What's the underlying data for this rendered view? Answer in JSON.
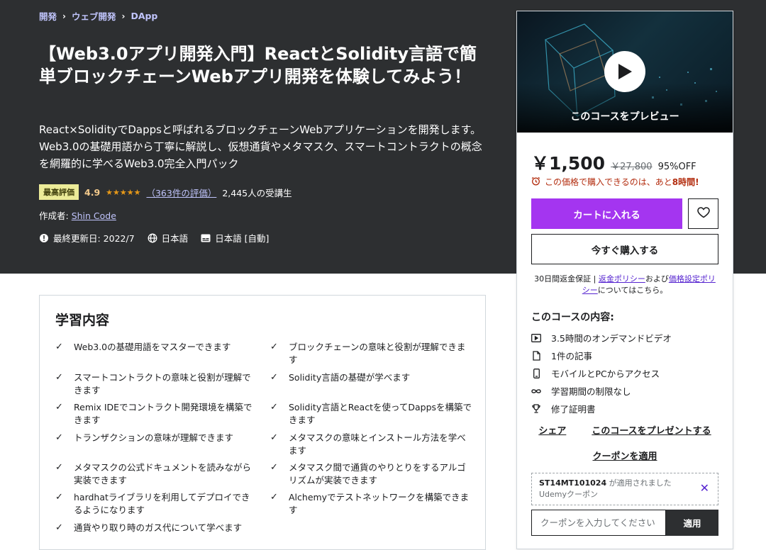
{
  "breadcrumb": [
    "開発",
    "ウェブ開発",
    "DApp"
  ],
  "course": {
    "title": "【Web3.0アプリ開発入門】ReactとSolidity言語で簡単ブロックチェーンWebアプリ開発を体験してみよう！",
    "subtitle": "React×SolidityでDappsと呼ばれるブロックチェーンWebアプリケーションを開発します。Web3.0の基礎用語から丁寧に解説し、仮想通貨やメタマスク、スマートコントラクトの概念を網羅的に学べるWeb3.0完全入門パック",
    "badge": "最高評価",
    "rating": "4.9",
    "stars": "★★★★★",
    "rating_count": "（363件の評価）",
    "students": "2,445人の受講生",
    "author_label": "作成者:",
    "author": "Shin Code",
    "updated": "最終更新日: 2022/7",
    "language": "日本語",
    "captions": "日本語 [自動]"
  },
  "learn": {
    "title": "学習内容",
    "left": [
      "Web3.0の基礎用語をマスターできます",
      "スマートコントラクトの意味と役割が理解できます",
      "Remix IDEでコントラクト開発環境を構築できます",
      "トランザクションの意味が理解できます",
      "メタマスクの公式ドキュメントを読みながら実装できます",
      "hardhatライブラリを利用してデプロイできるようになります",
      "通貨やり取り時のガス代について学べます"
    ],
    "right": [
      "ブロックチェーンの意味と役割が理解できます",
      "Solidity言語の基礎が学べます",
      "Solidity言語とReactを使ってDappsを構築できます",
      "メタマスクの意味とインストール方法を学べます",
      "メタマスク間で通貨のやりとりをするアルゴリズムが実装できます",
      "Alchemyでテストネットワークを構築できます"
    ]
  },
  "sidebar": {
    "preview_label": "このコースをプレビュー",
    "price": "￥1,500",
    "old_price": "￥27,800",
    "discount": "95%OFF",
    "timer_text": "この価格で購入できるのは、あと",
    "timer_bold": "8時間!",
    "cart_button": "カートに入れる",
    "buy_button": "今すぐ購入する",
    "guarantee_prefix": "30日間返金保証 | ",
    "refund_link": "返金ポリシー",
    "and_text": "および",
    "pricing_link": "価格設定ポリシー",
    "guarantee_suffix": "についてはこちら。",
    "includes_title": "このコースの内容:",
    "includes": [
      {
        "icon": "video-icon",
        "text": "3.5時間のオンデマンドビデオ"
      },
      {
        "icon": "article-icon",
        "text": "1件の記事"
      },
      {
        "icon": "mobile-icon",
        "text": "モバイルとPCからアクセス"
      },
      {
        "icon": "infinity-icon",
        "text": "学習期間の制限なし"
      },
      {
        "icon": "trophy-icon",
        "text": "修了証明書"
      }
    ],
    "share": "シェア",
    "gift": "このコースをプレゼントする",
    "apply_coupon": "クーポンを適用",
    "coupon_code": "ST14MT101024",
    "coupon_applied": "が適用されました",
    "coupon_source": "Udemyクーポン",
    "coupon_placeholder": "クーポンを入力してください",
    "apply_button": "適用"
  },
  "colors": {
    "hero_bg": "#2d2f31",
    "accent": "#a435f0",
    "link_light": "#c0c4fc",
    "rating": "#e59819",
    "timer": "#b32d0f"
  }
}
